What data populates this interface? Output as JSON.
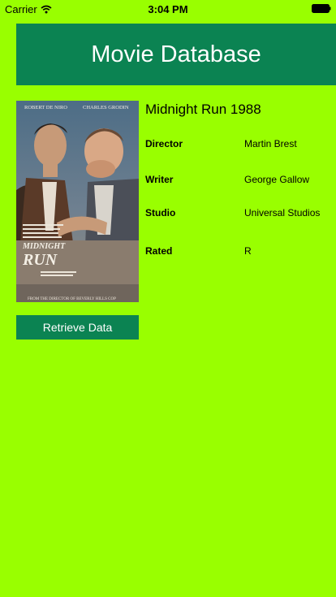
{
  "status_bar": {
    "carrier": "Carrier",
    "time": "3:04 PM",
    "wifi_icon": "wifi-icon",
    "battery_icon": "battery-icon"
  },
  "header": {
    "title": "Movie Database"
  },
  "poster": {
    "actor_left": "ROBERT DE NIRO",
    "actor_right": "CHARLES GRODIN",
    "title_line1": "MIDNIGHT",
    "title_line2": "RUN",
    "footer": "FROM THE DIRECTOR OF BEVERLY HILLS COP"
  },
  "movie": {
    "title": "Midnight Run 1988",
    "details": [
      {
        "label": "Director",
        "value": "Martin Brest"
      },
      {
        "label": "Writer",
        "value": "George Gallow"
      },
      {
        "label": "Studio",
        "value": "Universal Studios"
      },
      {
        "label": "Rated",
        "value": "R"
      }
    ]
  },
  "actions": {
    "retrieve_label": "Retrieve Data"
  },
  "colors": {
    "background": "#99ff00",
    "accent": "#0b8352",
    "accent_text": "#ffffff"
  }
}
